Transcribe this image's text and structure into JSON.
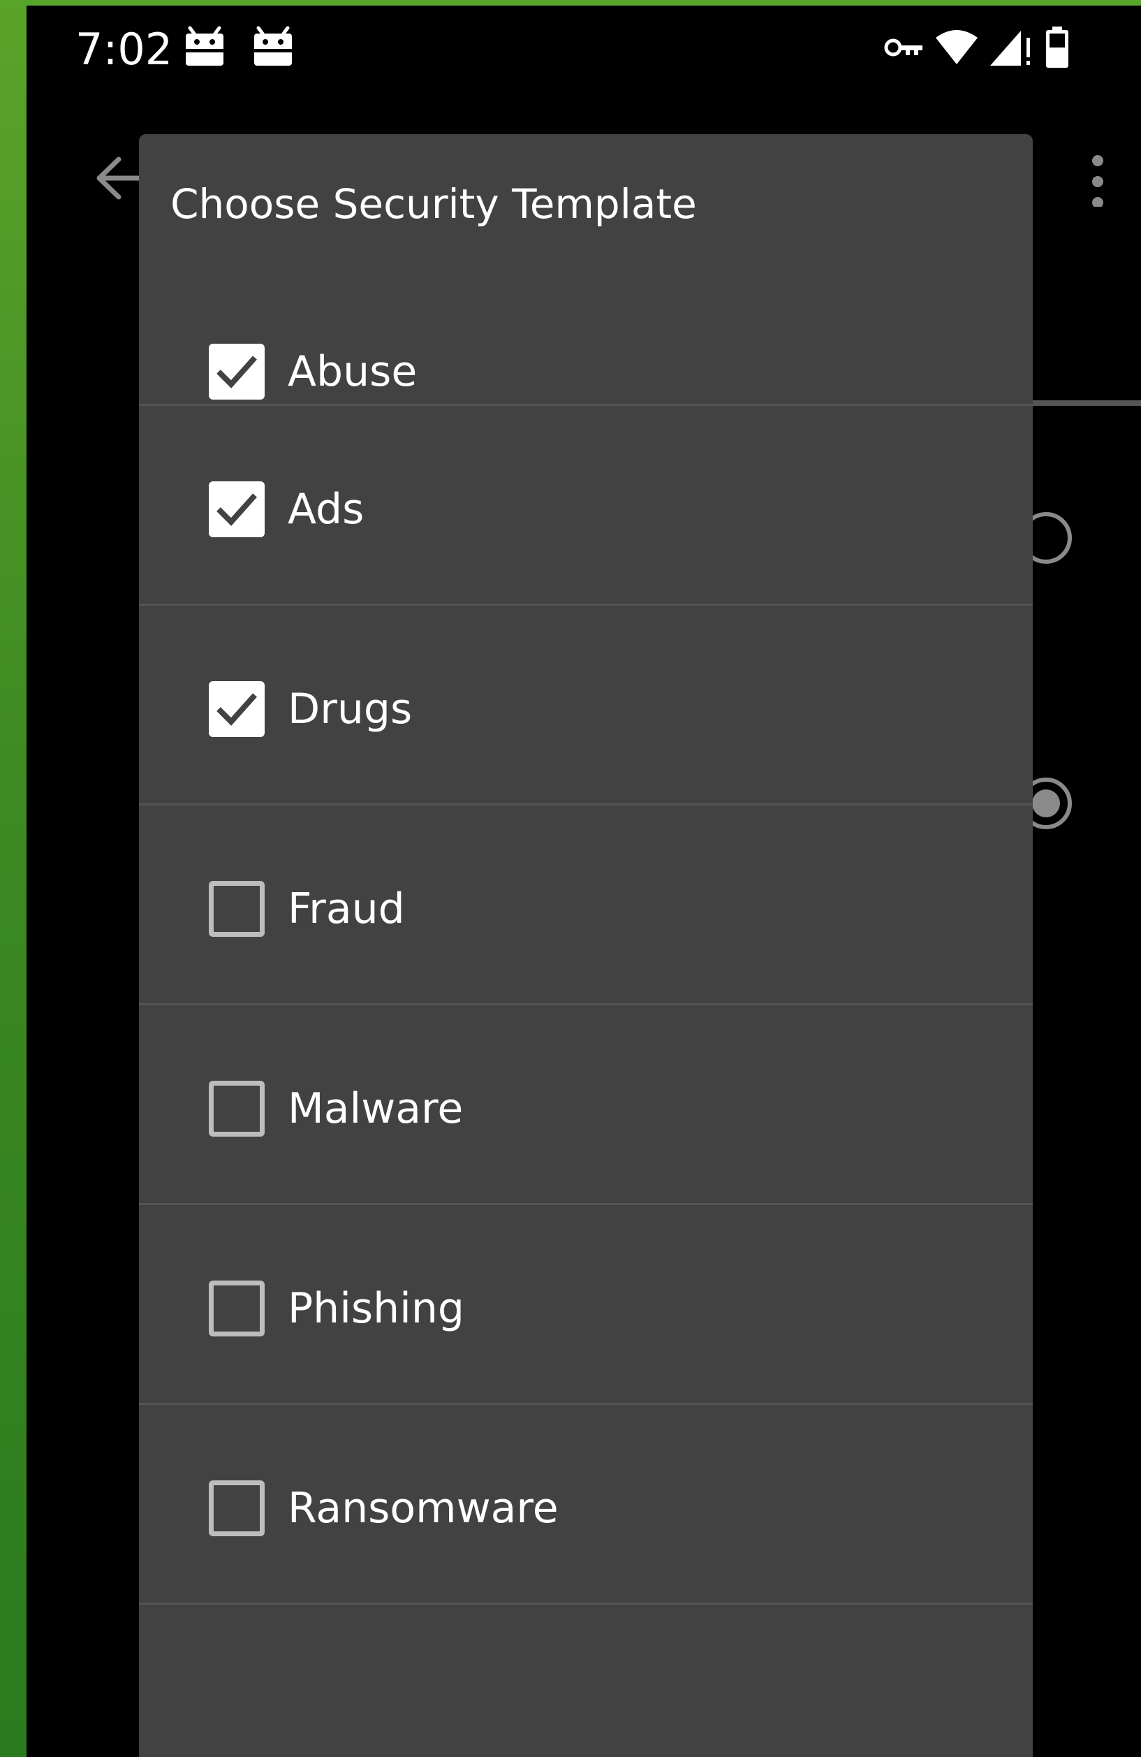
{
  "status_bar": {
    "time": "7:02",
    "notification_icons": [
      "android-notification-icon",
      "android-notification-icon"
    ],
    "system_icons": [
      "vpn-key-icon",
      "wifi-icon",
      "signal-icon",
      "battery-icon"
    ]
  },
  "background_app": {
    "back_icon": "arrow-back-icon",
    "menu_icon": "more-vert-icon"
  },
  "dialog": {
    "title": "Choose Security Template",
    "options": [
      {
        "label": "Abuse",
        "checked": true
      },
      {
        "label": "Ads",
        "checked": true
      },
      {
        "label": "Drugs",
        "checked": true
      },
      {
        "label": "Fraud",
        "checked": false
      },
      {
        "label": "Malware",
        "checked": false
      },
      {
        "label": "Phishing",
        "checked": false
      },
      {
        "label": "Ransomware",
        "checked": false
      }
    ]
  },
  "colors": {
    "dialog_bg": "#424242",
    "screen_bg": "#000000",
    "accent_green": "#5aa32a",
    "divider": "#545454"
  }
}
